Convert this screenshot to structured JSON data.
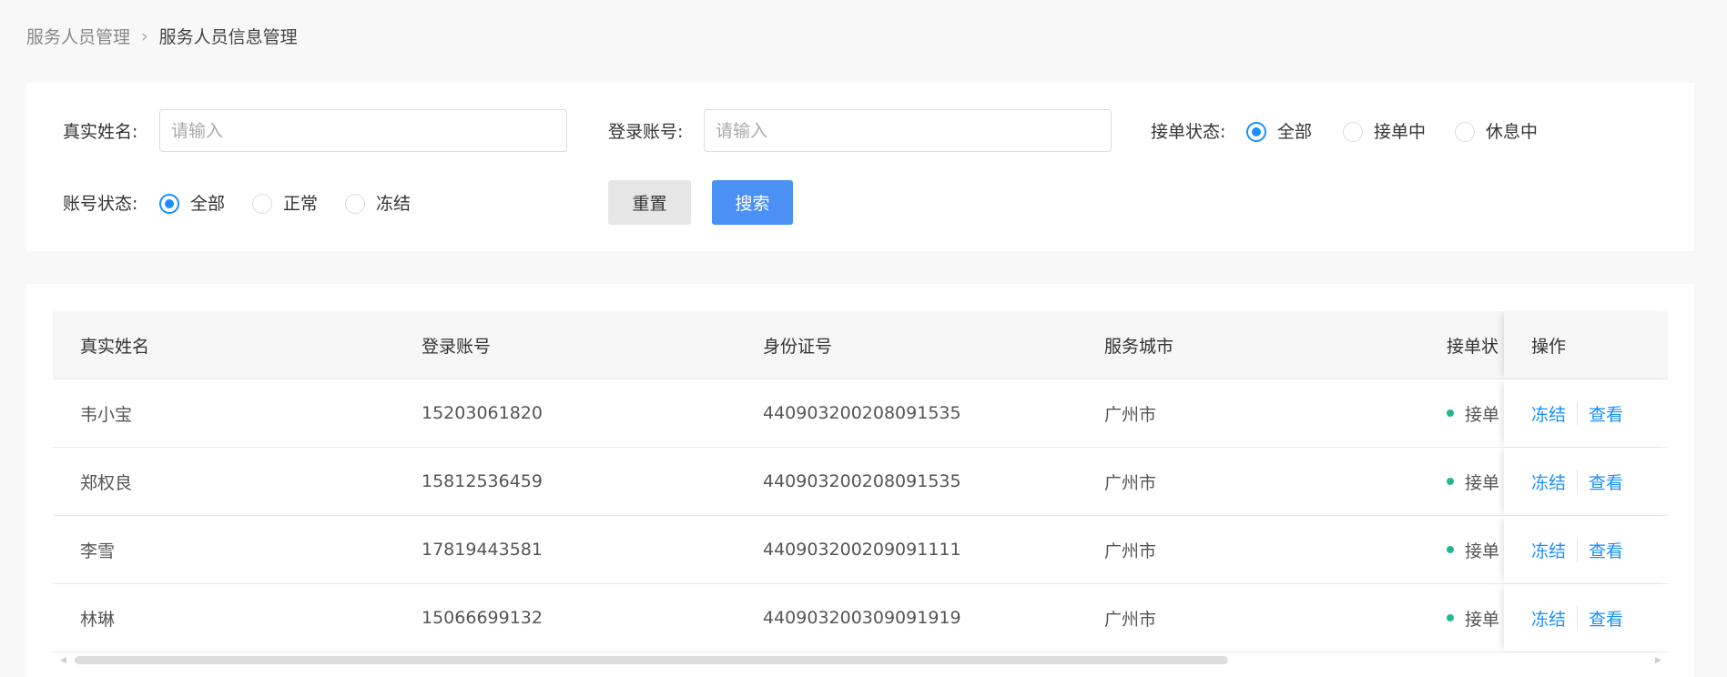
{
  "breadcrumb": {
    "parent": "服务人员管理",
    "separator": "›",
    "current": "服务人员信息管理"
  },
  "filters": {
    "real_name": {
      "label": "真实姓名:",
      "placeholder": "请输入",
      "value": ""
    },
    "account": {
      "label": "登录账号:",
      "placeholder": "请输入",
      "value": ""
    },
    "order_status": {
      "label": "接单状态:",
      "options": [
        "全部",
        "接单中",
        "休息中"
      ],
      "selected": "全部"
    },
    "account_status": {
      "label": "账号状态:",
      "options": [
        "全部",
        "正常",
        "冻结"
      ],
      "selected": "全部"
    },
    "reset_label": "重置",
    "search_label": "搜索"
  },
  "colors": {
    "primary": "#1890ff",
    "search_button": "#4a90f5",
    "status_dot": "#22b891"
  },
  "table": {
    "columns": [
      "真实姓名",
      "登录账号",
      "身份证号",
      "服务城市",
      "接单状",
      "操作"
    ],
    "rows": [
      {
        "name": "韦小宝",
        "account": "15203061820",
        "id_no": "440903200208091535",
        "city": "广州市",
        "status": "接单"
      },
      {
        "name": "郑权良",
        "account": "15812536459",
        "id_no": "440903200208091535",
        "city": "广州市",
        "status": "接单"
      },
      {
        "name": "李雪",
        "account": "17819443581",
        "id_no": "440903200209091111",
        "city": "广州市",
        "status": "接单"
      },
      {
        "name": "林琳",
        "account": "15066699132",
        "id_no": "440903200309091919",
        "city": "广州市",
        "status": "接单"
      }
    ],
    "actions": {
      "freeze": "冻结",
      "view": "查看"
    }
  }
}
